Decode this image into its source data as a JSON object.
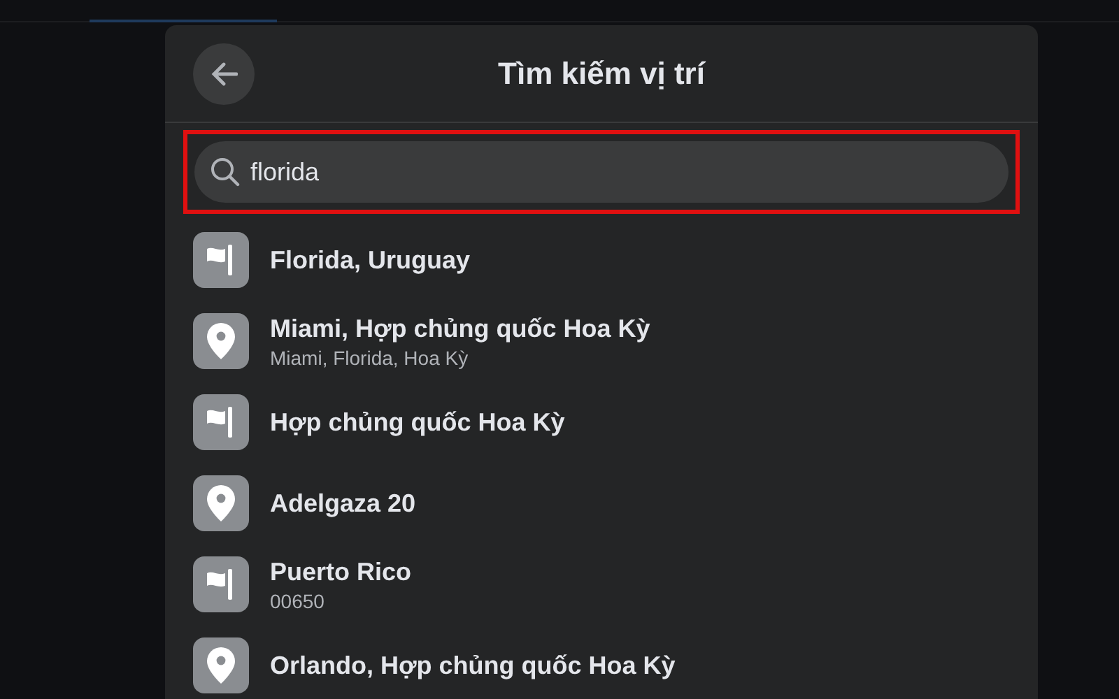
{
  "dialog": {
    "title": "Tìm kiếm vị trí"
  },
  "search": {
    "value": "florida"
  },
  "results": [
    {
      "kind": "flag",
      "title": "Florida, Uruguay"
    },
    {
      "kind": "pin",
      "title": "Miami, Hợp chủng quốc Hoa Kỳ",
      "subtitle": "Miami, Florida, Hoa Kỳ"
    },
    {
      "kind": "flag",
      "title": "Hợp chủng quốc Hoa Kỳ"
    },
    {
      "kind": "pin",
      "title": "Adelgaza 20"
    },
    {
      "kind": "flag",
      "title": "Puerto Rico",
      "subtitle": "00650"
    },
    {
      "kind": "pin",
      "title": "Orlando, Hợp chủng quốc Hoa Kỳ"
    }
  ]
}
